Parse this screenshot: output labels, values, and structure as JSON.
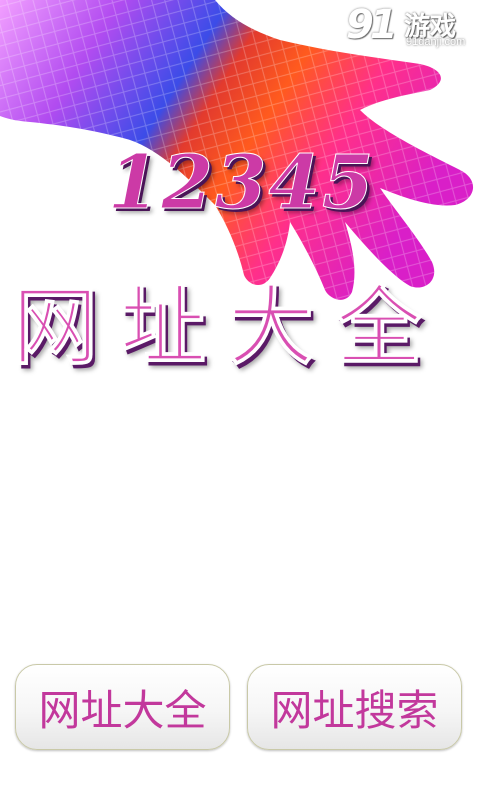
{
  "logo": {
    "number": "91",
    "name": "游戏",
    "domain": "91danji.com"
  },
  "hero": {
    "title_number": "12345",
    "title_text": "网址大全"
  },
  "buttons": {
    "left_label": "网址大全",
    "right_label": "网址搜索"
  },
  "colors": {
    "accent": "#c2389c",
    "button_border": "#c9c9a8",
    "background": "#ffffff"
  },
  "icons": {
    "hero_image": "rainbow-hand-icon"
  }
}
